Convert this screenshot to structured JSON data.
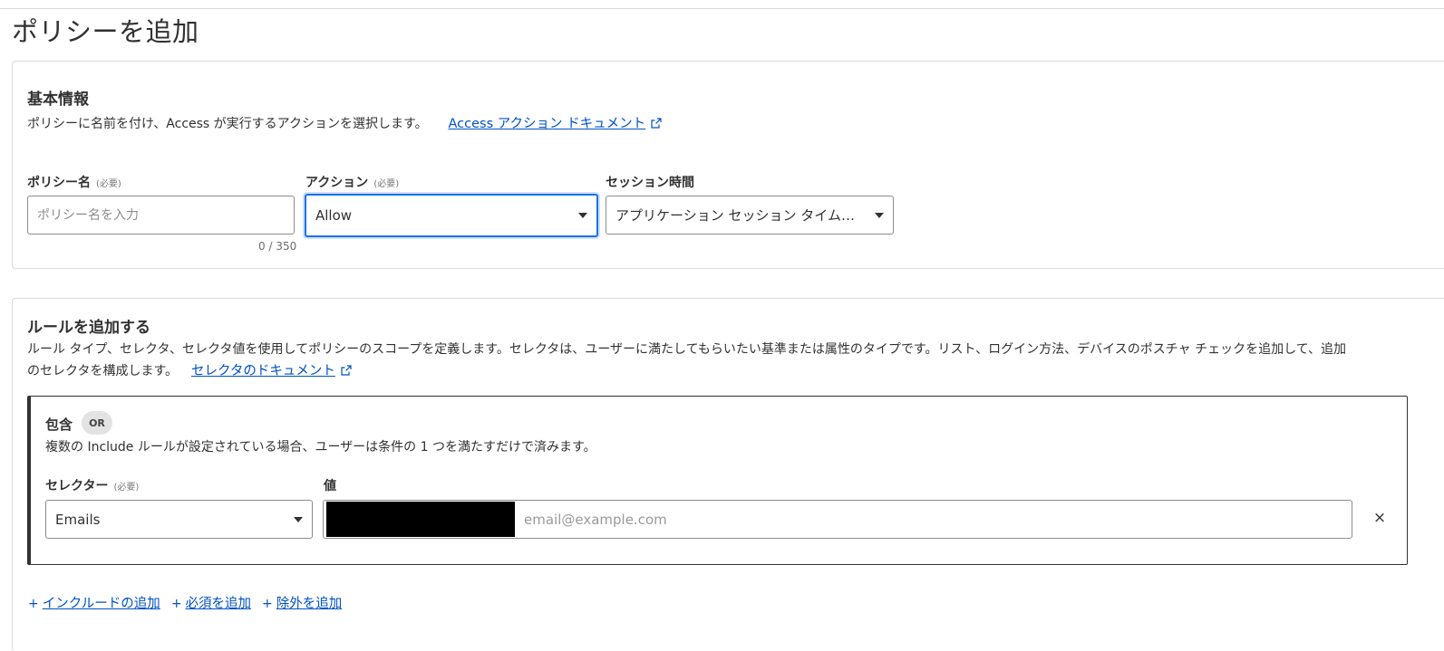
{
  "page": {
    "title": "ポリシーを追加"
  },
  "basic_info": {
    "title": "基本情報",
    "description": "ポリシーに名前を付け、Access が実行するアクションを選択します。",
    "doc_link": "Access アクション ドキュメント",
    "policy_name": {
      "label": "ポリシー名",
      "required": "(必要)",
      "placeholder": "ポリシー名を入力",
      "value": "",
      "counter": "0 / 350"
    },
    "action": {
      "label": "アクション",
      "required": "(必要)",
      "value": "Allow"
    },
    "session": {
      "label": "セッション時間",
      "value": "アプリケーション セッション タイムアウトと同じ"
    }
  },
  "rules": {
    "title": "ルールを追加する",
    "description_line1": "ルール タイプ、セレクタ、セレクタ値を使用してポリシーのスコープを定義します。セレクタは、ユーザーに満たしてもらいたい基準または属性のタイプです。リスト、ログイン方法、デバイスのポスチャ チェックを追加して、追加",
    "description_line2": "のセレクタを構成します。",
    "doc_link": "セレクタのドキュメント",
    "include": {
      "title": "包含",
      "badge": "OR",
      "description": "複数の Include ルールが設定されている場合、ユーザーは条件の 1 つを満たすだけで済みます。",
      "selector": {
        "label": "セレクター",
        "required": "(必要)",
        "value": "Emails"
      },
      "value": {
        "label": "値",
        "placeholder": "email@example.com"
      },
      "remove": "×"
    },
    "add_links": {
      "include": "インクルードの追加",
      "require": "必須を追加",
      "exclude": "除外を追加"
    }
  },
  "colors": {
    "link": "#0051c3",
    "focus": "#1a73e8",
    "text": "#313131",
    "border": "#8c8c8c"
  },
  "icons": {
    "external": "external-link-icon",
    "caret": "caret-down-icon",
    "plus": "plus-icon",
    "close": "close-icon"
  }
}
